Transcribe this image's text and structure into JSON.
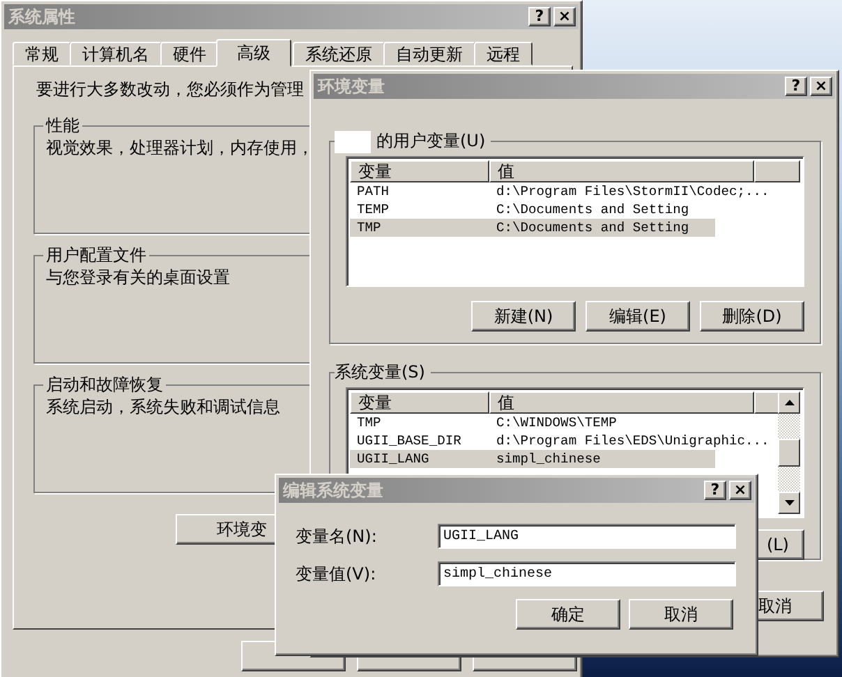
{
  "system_properties": {
    "title": "系统属性",
    "title_buttons": [
      "?",
      "×"
    ],
    "tabs": [
      {
        "label": "常规",
        "selected": false
      },
      {
        "label": "计算机名",
        "selected": false
      },
      {
        "label": "硬件",
        "selected": false
      },
      {
        "label": "高级",
        "selected": true
      },
      {
        "label": "系统还原",
        "selected": false
      },
      {
        "label": "自动更新",
        "selected": false
      },
      {
        "label": "远程",
        "selected": false
      }
    ],
    "notice": "要进行大多数改动，您必须作为管理",
    "groups": [
      {
        "title": "性能",
        "description": "视觉效果，处理器计划，内存使用，"
      },
      {
        "title": "用户配置文件",
        "description": "与您登录有关的桌面设置"
      },
      {
        "title": "启动和故障恢复",
        "description": "系统启动，系统失败和调试信息"
      }
    ],
    "env_button": "环境变"
  },
  "environment_variables": {
    "title": "环境变量",
    "title_buttons": [
      "?",
      "×"
    ],
    "user_group_label": "的用户变量(U)",
    "user_columns": [
      "变量",
      "值"
    ],
    "user_rows": [
      {
        "name": "PATH",
        "value": "d:\\Program Files\\StormII\\Codec;...",
        "selected": false
      },
      {
        "name": "TEMP",
        "value": "C:\\Documents and Setting",
        "selected": false
      },
      {
        "name": "TMP",
        "value": "C:\\Documents and Setting",
        "selected": true
      }
    ],
    "user_buttons": [
      "新建(N)",
      "编辑(E)",
      "删除(D)"
    ],
    "system_group_label": "系统变量(S)",
    "system_columns": [
      "变量",
      "值"
    ],
    "system_rows": [
      {
        "name": "TMP",
        "value": "C:\\WINDOWS\\TEMP",
        "selected": false
      },
      {
        "name": "UGII_BASE_DIR",
        "value": "d:\\Program Files\\EDS\\Unigraphic...",
        "selected": false
      },
      {
        "name": "UGII_LANG",
        "value": "simpl_chinese",
        "selected": true
      }
    ],
    "system_button": "(L)",
    "cancel_button": "取消"
  },
  "edit_dialog": {
    "title": "编辑系统变量",
    "title_buttons": [
      "?",
      "×"
    ],
    "fields": [
      {
        "label": "变量名(N):",
        "value": "UGII_LANG"
      },
      {
        "label": "变量值(V):",
        "value": "simpl_chinese"
      }
    ],
    "buttons": [
      "确定",
      "取消"
    ]
  }
}
